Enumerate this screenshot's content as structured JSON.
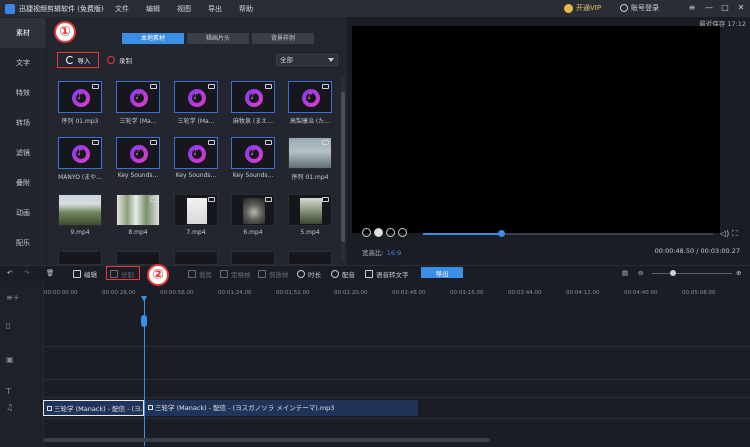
{
  "titlebar": {
    "app_title": "迅捷视频剪辑软件 (免费版)",
    "menu": [
      "文件",
      "编辑",
      "视图",
      "导出",
      "帮助"
    ],
    "vip_label": "开通VIP",
    "login_label": "账号登录"
  },
  "rail": {
    "items": [
      {
        "label": "素材",
        "active": true
      },
      {
        "label": "文字"
      },
      {
        "label": "特效"
      },
      {
        "label": "转场"
      },
      {
        "label": "滤镜"
      },
      {
        "label": "叠附"
      },
      {
        "label": "动画"
      },
      {
        "label": "配乐"
      }
    ]
  },
  "media": {
    "tabs": [
      {
        "label": "本地素材",
        "active": true
      },
      {
        "label": "辑画片头"
      },
      {
        "label": "背景样例"
      }
    ],
    "import_label": "导入",
    "record_label": "录制",
    "filter_value": "全部",
    "items": [
      {
        "label": "序列 01.mp3",
        "kind": "audio"
      },
      {
        "label": "三轮学 (Ma...",
        "kind": "audio"
      },
      {
        "label": "三轮学 (Ma...",
        "kind": "audio"
      },
      {
        "label": "麻牧泉 (まえ...",
        "kind": "audio"
      },
      {
        "label": "高梨康治 (た...",
        "kind": "audio"
      },
      {
        "label": "MANYO (まや...",
        "kind": "audio"
      },
      {
        "label": "Key Sounds...",
        "kind": "audio"
      },
      {
        "label": "Key Sounds...",
        "kind": "audio"
      },
      {
        "label": "Key Sounds...",
        "kind": "audio"
      },
      {
        "label": "序列 01.mp4",
        "kind": "video"
      },
      {
        "label": "9.mp4",
        "kind": "video"
      },
      {
        "label": "8.mp4",
        "kind": "video"
      },
      {
        "label": "7.mp4",
        "kind": "video"
      },
      {
        "label": "6.mp4",
        "kind": "video"
      },
      {
        "label": "5.mp4",
        "kind": "video"
      }
    ]
  },
  "preview": {
    "last_save": "最近保存 17:12",
    "ratio_label": "宽高比:",
    "ratio_value": "16:9",
    "timecode": "00:00:48.50 / 00:03:00.27",
    "progress": 0.27
  },
  "toolbar": {
    "edit": "编辑",
    "split": "分割",
    "crop": "裁剪",
    "freeze": "定格帧",
    "reverse": "倒放帧",
    "duration": "时长",
    "dub": "配音",
    "speech_to_text": "语音转文字",
    "export": "导出"
  },
  "timeline": {
    "ticks": [
      "00:00:00.00",
      "00:00:28.00",
      "00:00:56.00",
      "00:01:24.00",
      "00:01:52.00",
      "00:02:20.00",
      "00:02:48.00",
      "00:03:16.00",
      "00:03:44.00",
      "00:04:12.00",
      "00:04:40.00",
      "00:05:08.00"
    ],
    "clip_a": "三轮学 (Manack) - 配信 - (ヨ...",
    "clip_b": "三轮学 (Manack) - 配信 - (ヨスガノソラ メインテーマ).mp3"
  },
  "callouts": [
    "①",
    "②"
  ],
  "colors": {
    "accent": "#3a8ee6",
    "highlight_box": "#e53935",
    "vip": "#e8c56e"
  }
}
